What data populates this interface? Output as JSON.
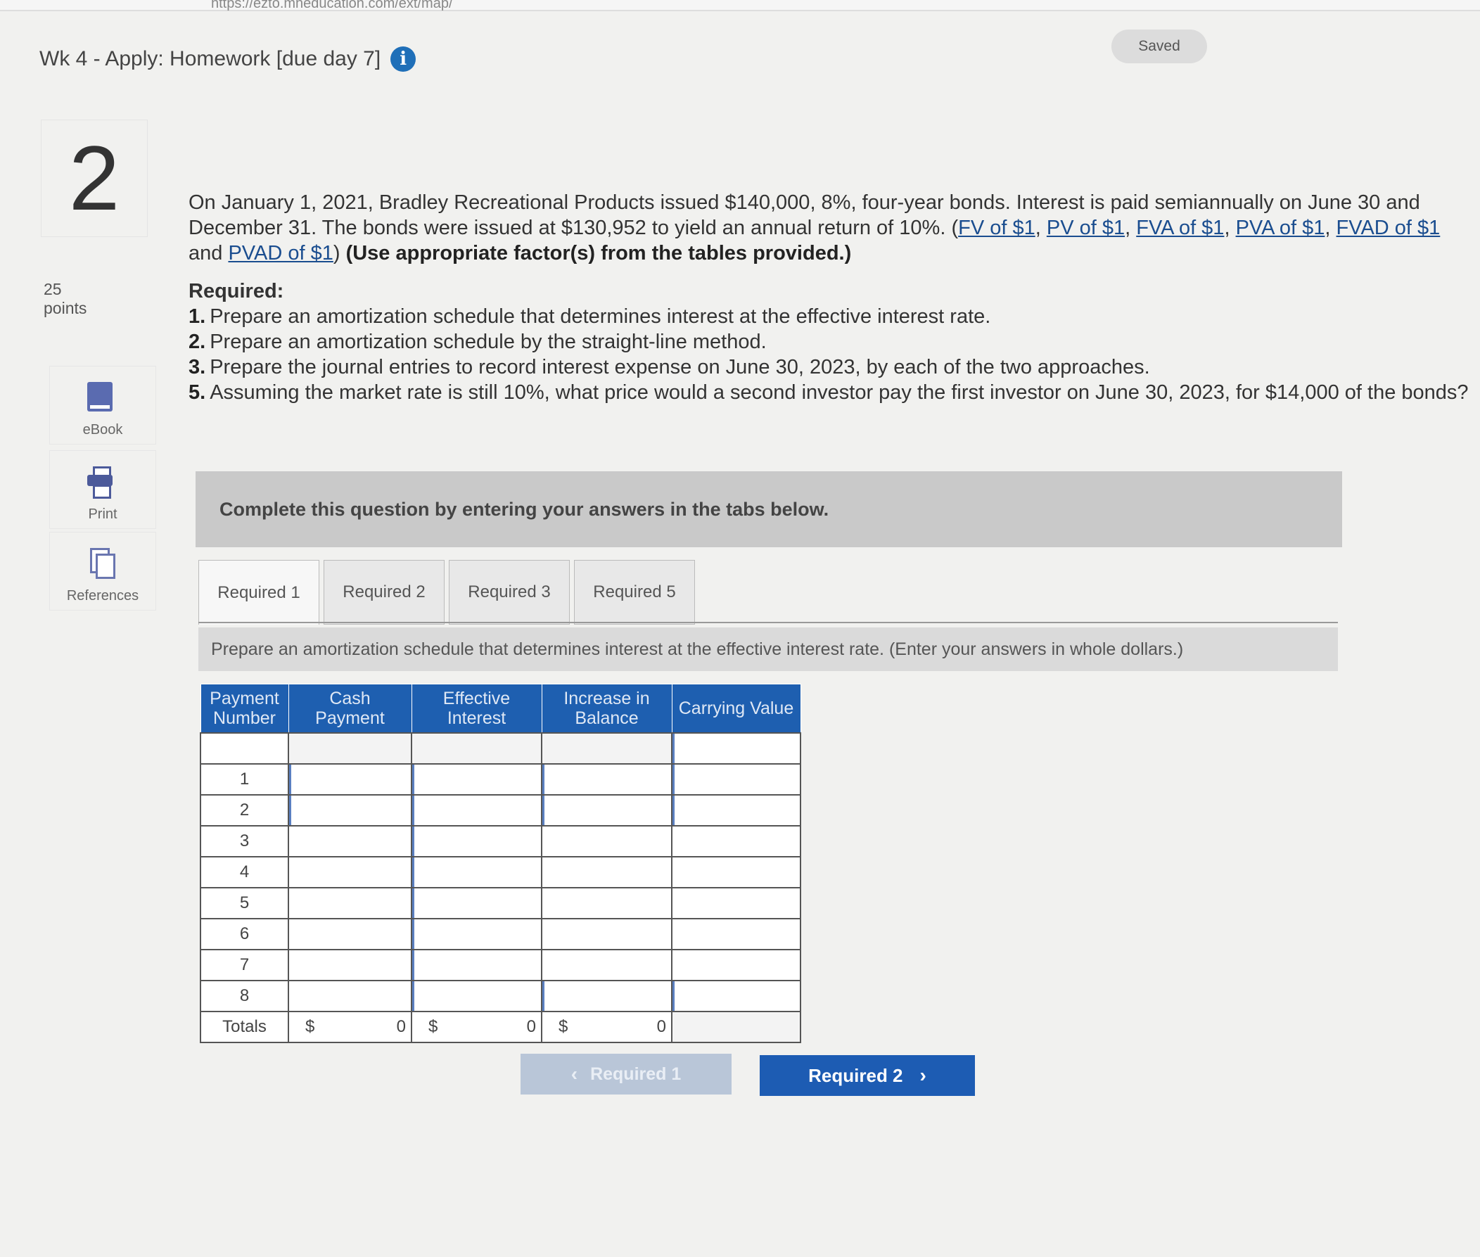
{
  "browser": {
    "url": "https://ezto.mheducation.com/ext/map/"
  },
  "header": {
    "title": "Wk 4 - Apply: Homework [due day 7]",
    "save_status": "Saved"
  },
  "question": {
    "number": "2",
    "points_value": "25",
    "points_label": "points"
  },
  "sidebar": {
    "ebook": "eBook",
    "print": "Print",
    "references": "References"
  },
  "problem": {
    "text": "On January 1, 2021, Bradley Recreational Products issued $140,000, 8%, four-year bonds. Interest is paid semiannually on June 30 and December 31. The bonds were issued at $130,952 to yield an annual return of 10%. (",
    "links": [
      "FV of $1",
      "PV of $1",
      "FVA of $1",
      "PVA of $1",
      "FVAD of $1",
      "PVAD of $1"
    ],
    "link_sep": ", ",
    "and_word": " and ",
    "close_paren": ")",
    "instruction_bold": "(Use appropriate factor(s) from the tables provided.)",
    "required_heading": "Required:",
    "requirements": [
      {
        "num": "1.",
        "text": "Prepare an amortization schedule that determines interest at the effective interest rate."
      },
      {
        "num": "2.",
        "text": "Prepare an amortization schedule by the straight-line method."
      },
      {
        "num": "3.",
        "text": "Prepare the journal entries to record interest expense on June 30, 2023, by each of the two approaches."
      },
      {
        "num": "5.",
        "text": "Assuming the market rate is still 10%, what price would a second investor pay the first investor on June 30, 2023, for $14,000 of the bonds?"
      }
    ]
  },
  "complete_banner": "Complete this question by entering your answers in the tabs below.",
  "tabs": [
    {
      "label": "Required 1",
      "active": true
    },
    {
      "label": "Required 2",
      "active": false
    },
    {
      "label": "Required 3",
      "active": false
    },
    {
      "label": "Required 5",
      "active": false
    }
  ],
  "instruction": "Prepare an amortization schedule that determines interest at the effective interest rate. (Enter your answers in whole dollars.)",
  "table": {
    "headers": [
      "Payment\nNumber",
      "Cash\nPayment",
      "Effective\nInterest",
      "Increase in\nBalance",
      "Carrying Value"
    ],
    "rows": [
      "1",
      "2",
      "3",
      "4",
      "5",
      "6",
      "7",
      "8"
    ],
    "totals_label": "Totals",
    "currency": "$",
    "totals": [
      "0",
      "0",
      "0"
    ]
  },
  "nav": {
    "prev": "Required 1",
    "next": "Required 2"
  },
  "colors": {
    "accent": "#1d5cb3",
    "header_bg": "#1e5fb0",
    "info_icon": "#1f6fb8"
  }
}
